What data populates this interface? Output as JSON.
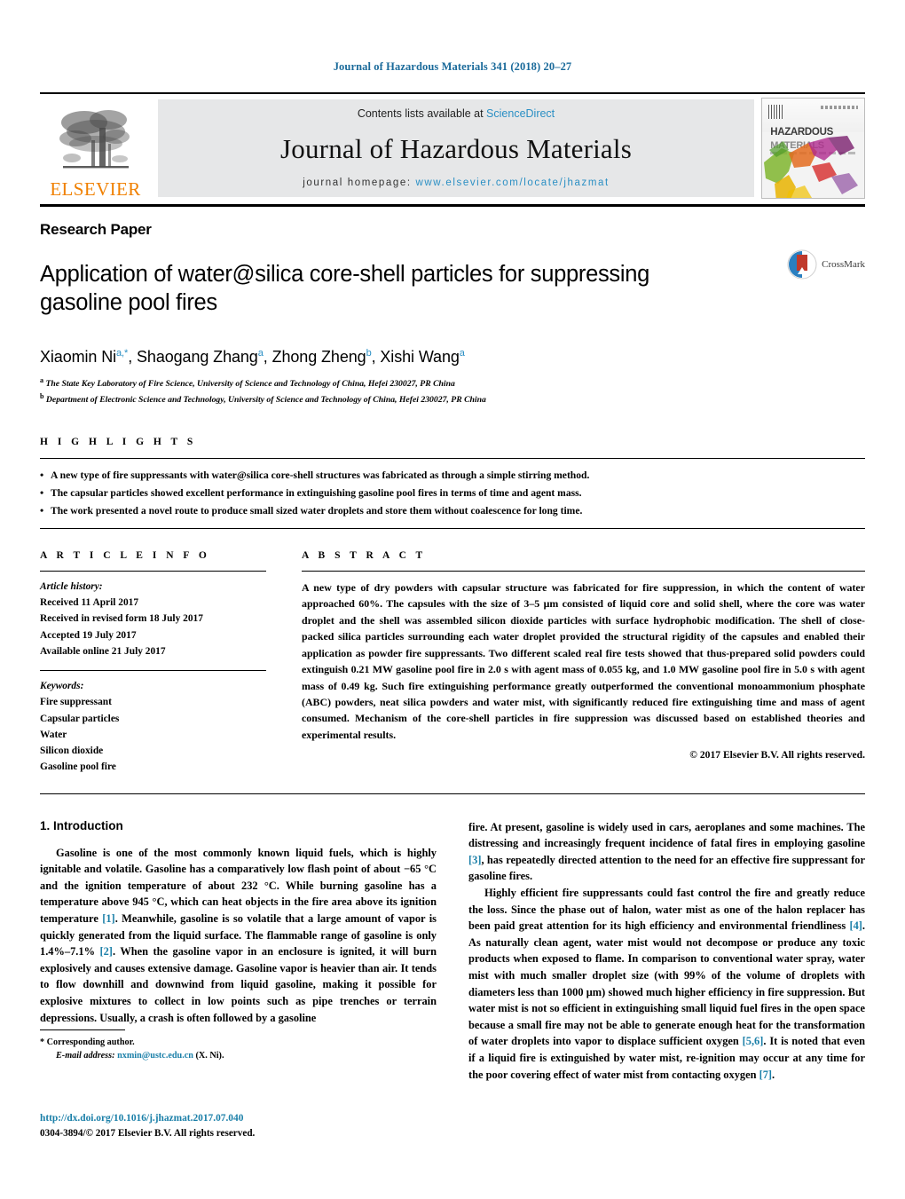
{
  "running_head": "Journal of Hazardous Materials 341 (2018) 20–27",
  "masthead": {
    "contents_prefix": "Contents lists available at ",
    "sciencedirect": "ScienceDirect",
    "journal_title": "Journal of Hazardous Materials",
    "homepage_prefix": "journal homepage: ",
    "homepage_url": "www.elsevier.com/locate/jhazmat",
    "publisher": "ELSEVIER",
    "publisher_logo_icon": "elsevier-tree-icon",
    "cover_line1": "HAZARDOUS",
    "cover_line2": "MATERIALS",
    "cover_icon": "journal-cover-thumbnail"
  },
  "article": {
    "type": "Research Paper",
    "title": "Application of water@silica core-shell particles for suppressing gasoline pool fires",
    "crossmark_label": "CrossMark",
    "crossmark_icon": "crossmark-icon",
    "authors": [
      {
        "name": "Xiaomin Ni",
        "sup": "a,*"
      },
      {
        "name": "Shaogang Zhang",
        "sup": "a"
      },
      {
        "name": "Zhong Zheng",
        "sup": "b"
      },
      {
        "name": "Xishi Wang",
        "sup": "a"
      }
    ],
    "affiliations": [
      {
        "marker": "a",
        "text": "The State Key Laboratory of Fire Science, University of Science and Technology of China, Hefei 230027, PR China"
      },
      {
        "marker": "b",
        "text": "Department of Electronic Science and Technology, University of Science and Technology of China, Hefei 230027, PR China"
      }
    ]
  },
  "highlights": {
    "label": "H I G H L I G H T S",
    "items": [
      "A new type of fire suppressants with water@silica core-shell structures was fabricated as through a simple stirring method.",
      "The capsular particles showed excellent performance in extinguishing gasoline pool fires in terms of time and agent mass.",
      "The work presented a novel route to produce small sized water droplets and store them without coalescence for long time."
    ]
  },
  "article_info": {
    "label": "A R T I C L E    I N F O",
    "history_heading": "Article history:",
    "history": [
      "Received 11 April 2017",
      "Received in revised form 18 July 2017",
      "Accepted 19 July 2017",
      "Available online 21 July 2017"
    ],
    "keywords_heading": "Keywords:",
    "keywords": [
      "Fire suppressant",
      "Capsular particles",
      "Water",
      "Silicon dioxide",
      "Gasoline pool fire"
    ]
  },
  "abstract": {
    "label": "A B S T R A C T",
    "text": "A new type of dry powders with capsular structure was fabricated for fire suppression, in which the content of water approached 60%. The capsules with the size of 3–5 μm consisted of liquid core and solid shell, where the core was water droplet and the shell was assembled silicon dioxide particles with surface hydrophobic modification. The shell of close-packed silica particles surrounding each water droplet provided the structural rigidity of the capsules and enabled their application as powder fire suppressants. Two different scaled real fire tests showed that thus-prepared solid powders could extinguish 0.21 MW gasoline pool fire in 2.0 s with agent mass of 0.055 kg, and 1.0 MW gasoline pool fire in 5.0 s with agent mass of 0.49 kg. Such fire extinguishing performance greatly outperformed the conventional monoammonium phosphate (ABC) powders, neat silica powders and water mist, with significantly reduced fire extinguishing time and mass of agent consumed. Mechanism of the core-shell particles in fire suppression was discussed based on established theories and experimental results.",
    "copyright": "© 2017 Elsevier B.V. All rights reserved."
  },
  "body": {
    "section_heading": "1.  Introduction",
    "left_paragraph_1": "Gasoline is one of the most commonly known liquid fuels, which is highly ignitable and volatile. Gasoline has a comparatively low flash point of about −65 °C and the ignition temperature of about 232 °C. While burning gasoline has a temperature above 945 °C, which can heat objects in the fire area above its ignition temperature ",
    "left_ref_1": "[1]",
    "left_paragraph_1b": ". Meanwhile, gasoline is so volatile that a large amount of vapor is quickly generated from the liquid surface. The flammable range of gasoline is only 1.4%–7.1% ",
    "left_ref_2": "[2]",
    "left_paragraph_1c": ". When the gasoline vapor in an enclosure is ignited, it will burn explosively and causes extensive damage. Gasoline vapor is heavier than air. It tends to flow downhill and downwind from liquid gasoline, making it possible for explosive mixtures to collect in low points such as pipe trenches or terrain depressions. Usually, a crash is often followed by a gasoline",
    "right_paragraph_1": "fire. At present, gasoline is widely used in cars, aeroplanes and some machines. The distressing and increasingly frequent incidence of fatal fires in employing gasoline ",
    "right_ref_3": "[3]",
    "right_paragraph_1b": ", has repeatedly directed attention to the need for an effective fire suppressant for gasoline fires.",
    "right_paragraph_2": "Highly efficient fire suppressants could fast control the fire and greatly reduce the loss. Since the phase out of halon, water mist as one of the halon replacer has been paid great attention for its high efficiency and environmental friendliness ",
    "right_ref_4": "[4]",
    "right_paragraph_2b": ". As naturally clean agent, water mist would not decompose or produce any toxic products when exposed to flame. In comparison to conventional water spray, water mist with much smaller droplet size (with 99% of the volume of droplets with diameters less than 1000 μm) showed much higher efficiency in fire suppression. But water mist is not so efficient in extinguishing small liquid fuel fires in the open space because a small fire may not be able to generate enough heat for the transformation of water droplets into vapor to displace sufficient oxygen ",
    "right_ref_56": "[5,6]",
    "right_paragraph_2c": ". It is noted that even if a liquid fire is extinguished by water mist, re-ignition may occur at any time for the poor covering effect of water mist from contacting oxygen ",
    "right_ref_7": "[7]",
    "right_paragraph_2d": "."
  },
  "footnotes": {
    "corresponding_marker": "*",
    "corresponding_text": "Corresponding author.",
    "email_label": "E-mail address:",
    "email": "nxmin@ustc.edu.cn",
    "email_owner": "(X. Ni).",
    "doi": "http://dx.doi.org/10.1016/j.jhazmat.2017.07.040",
    "issn": "0304-3894/© 2017 Elsevier B.V. All rights reserved."
  },
  "colors": {
    "link": "#1a7fa8",
    "sciencedirect": "#2a8fc4",
    "elsevier_orange": "#F08000"
  }
}
